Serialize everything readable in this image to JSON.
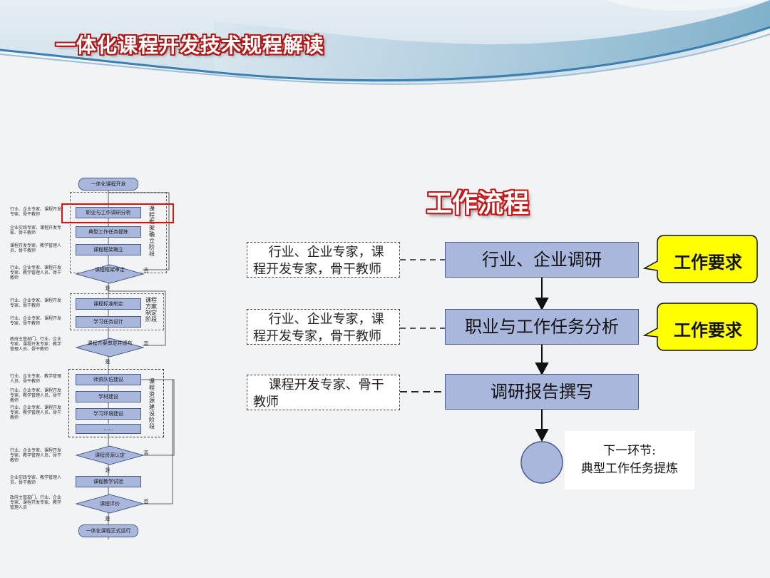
{
  "title": "一体化课程开发技术规程解读",
  "flow_title": "工作流程",
  "mini_chart": {
    "start": "一体化课程开发",
    "steps": [
      "职业与工作调研分析",
      "典型工作任务提炼",
      "课程框架确立",
      "课程框架审定",
      "课程标准制定",
      "学习任务设计",
      "课程方案审定并颁布",
      "师资队伍建设",
      "学材建设",
      "学习环境建设",
      "……",
      "课程资源认定",
      "课程教学试验",
      "课程评价",
      "一体化课程正式运行"
    ],
    "phases": [
      "课程框架确立阶段",
      "课程方案制定阶段",
      "课程资源建设阶段"
    ],
    "notes": [
      "行业、企业专家、课程开发专家、骨干教师",
      "企业实践专家、课程开发专家、骨干教师",
      "课程开发专家、教学管理人员、骨干教师",
      "行业、企业专家、课程开发专家、教学管理人员、骨干教师",
      "行业、企业专家、课程开发专家、骨干教师",
      "行业、企业专家、课程开发专家、骨干教师",
      "政府主管部门、行业、企业专家、课程开发专家、教学管理人员、骨干教师",
      "行业、企业专家、教学管理人员、骨干教师",
      "行业、企业专家、课程开发专家、教学管理人员、骨干教师",
      "行业、企业专家、课程开发专家、教学管理人员、骨干教师",
      "行业、企业专家、课程开发专家、教学管理人员、骨干教师",
      "企业实践专家、教学管理人员、骨干教师",
      "政府主管部门、行业、企业专家、课程开发专家、教学管理人员"
    ],
    "yes": "是",
    "no": "否"
  },
  "flow": {
    "participants": [
      "行业、企业专家，课程开发专家，骨干教师",
      "行业、企业专家，课程开发专家，骨干教师",
      "课程开发专家、骨干教师"
    ],
    "steps": [
      "行业、企业调研",
      "职业与工作任务分析",
      "调研报告撰写"
    ],
    "requirement_label": "工作要求",
    "next_line1": "下一环节:",
    "next_line2": "典型工作任务提炼"
  },
  "colors": {
    "step_fill": "#a9b7dd",
    "callout_fill": "#ffff00",
    "highlight": "#e01010",
    "title_stroke": "#b01818"
  }
}
